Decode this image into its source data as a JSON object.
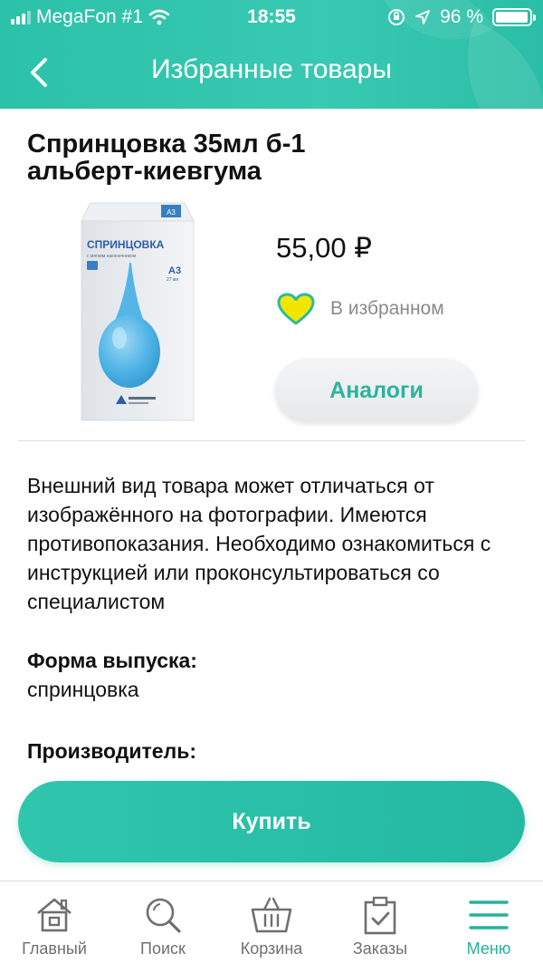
{
  "status_bar": {
    "carrier": "MegaFon #1",
    "time": "18:55",
    "battery": "96 %",
    "battery_level": 0.96
  },
  "header": {
    "title": "Избранные товары"
  },
  "product": {
    "title_line1": "Спринцовка 35мл б-1",
    "title_line2": "альберт-киевгума",
    "price": "55,00 ₽",
    "favorite_label": "В избранном",
    "analogs_label": "Аналоги",
    "package_text": {
      "brand": "СПРИНЦОВКА",
      "subtitle": "с мягким наконечником",
      "size": "А3",
      "volume": "27 мл",
      "top": "А3"
    }
  },
  "description": {
    "disclaimer": "Внешний вид товара может отличаться от изображённого на фотографии. Имеются противопоказания. Необходимо ознакомиться с инструкцией или проконсультироваться со специалистом",
    "form_label": "Форма выпуска:",
    "form_value": "спринцовка",
    "maker_label": "Производитель:"
  },
  "actions": {
    "buy_label": "Купить"
  },
  "tabbar": {
    "items": [
      {
        "label": "Главный",
        "icon": "home-icon"
      },
      {
        "label": "Поиск",
        "icon": "search-icon"
      },
      {
        "label": "Корзина",
        "icon": "basket-icon"
      },
      {
        "label": "Заказы",
        "icon": "clipboard-icon"
      },
      {
        "label": "Меню",
        "icon": "menu-icon",
        "active": true
      }
    ]
  },
  "colors": {
    "accent": "#2cc1a9",
    "favorite_heart": "#f2e600",
    "active_tab": "#25b29c"
  }
}
